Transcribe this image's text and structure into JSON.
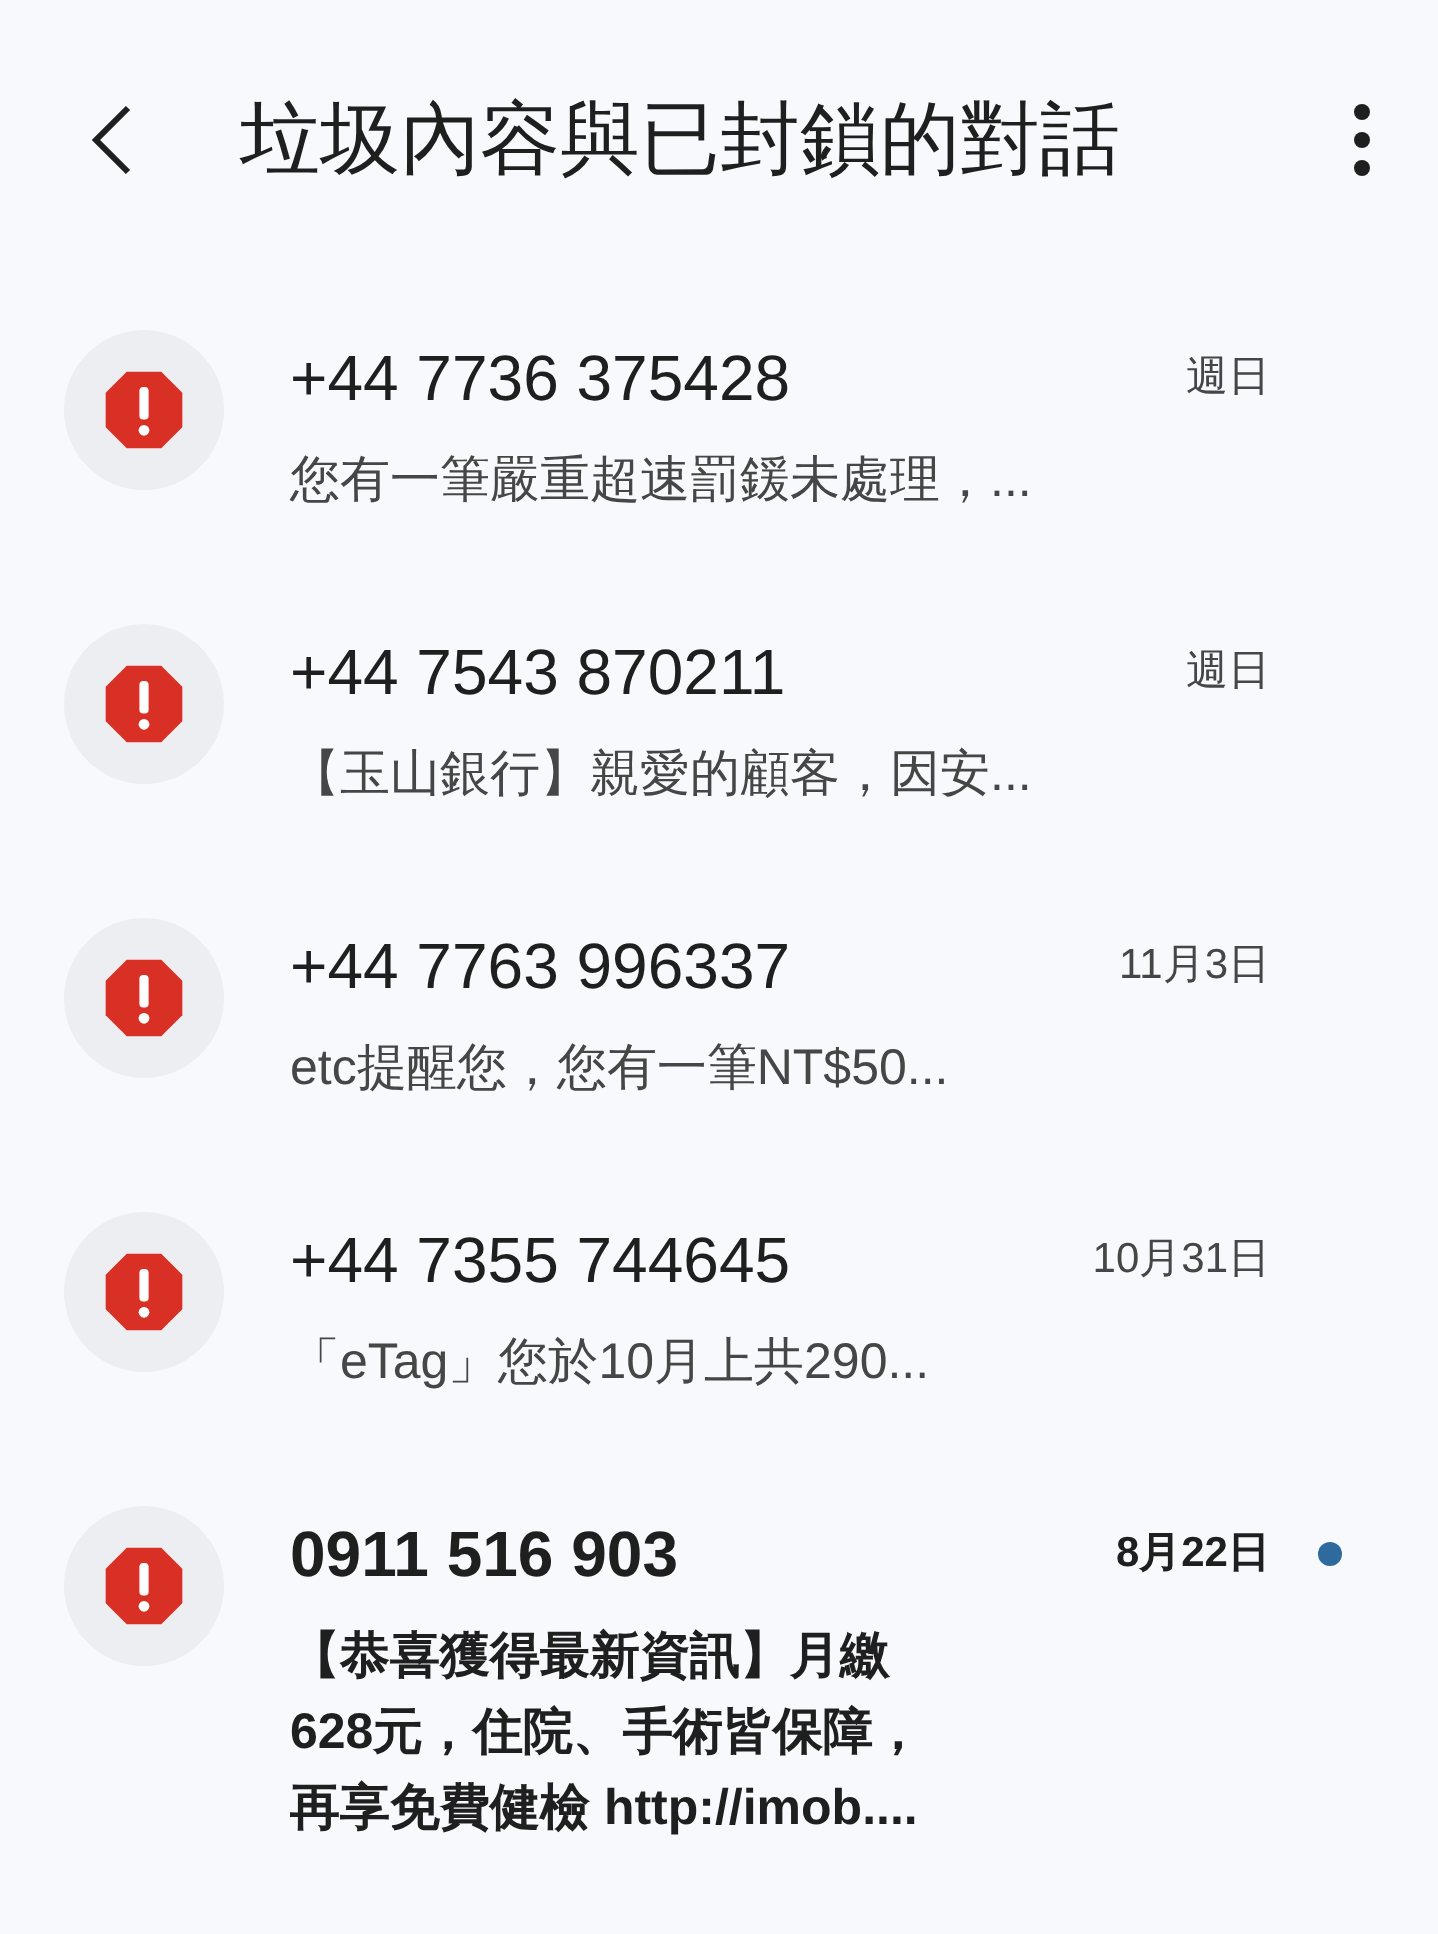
{
  "header": {
    "title": "垃圾內容與已封鎖的對話"
  },
  "conversations": [
    {
      "sender": "+44 7736 375428",
      "time": "週日",
      "preview": "您有一筆嚴重超速罰鍰未處理，...",
      "unread": false
    },
    {
      "sender": "+44 7543 870211",
      "time": "週日",
      "preview": "【玉山銀行】親愛的顧客，因安...",
      "unread": false
    },
    {
      "sender": "+44 7763 996337",
      "time": "11月3日",
      "preview": "etc提醒您，您有一筆NT$50...",
      "unread": false
    },
    {
      "sender": "+44 7355 744645",
      "time": "10月31日",
      "preview": "「eTag」您於10月上共290...",
      "unread": false
    },
    {
      "sender": "0911 516 903",
      "time": "8月22日",
      "preview": "【恭喜獲得最新資訊】月繳628元，住院、手術皆保障，再享免費健檢 http://imob....",
      "unread": true
    }
  ]
}
